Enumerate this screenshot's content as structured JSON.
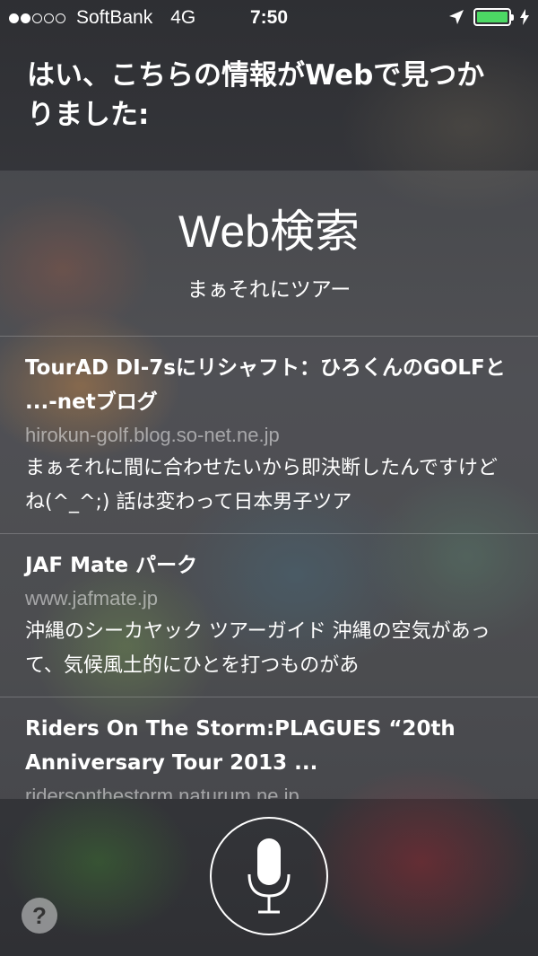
{
  "status_bar": {
    "carrier": "SoftBank",
    "network": "4G",
    "time": "7:50",
    "signal_bars_filled": 2,
    "signal_bars_total": 5,
    "battery_color": "#4cd964",
    "icons": [
      "location-arrow-icon",
      "battery-icon",
      "charging-bolt-icon"
    ]
  },
  "siri": {
    "response": "はい、こちらの情報がWebで見つかりました:"
  },
  "web_search": {
    "title": "Web検索",
    "query": "まぁそれにツアー",
    "results": [
      {
        "title": "TourAD DI-7sにリシャフト：ひろくんのGOLFと ...-netブログ",
        "url": "hirokun-golf.blog.so-net.ne.jp",
        "snippet": "まぁそれに間に合わせたいから即決断したんですけどね(^_^;) 話は変わって日本男子ツア"
      },
      {
        "title": "JAF Mate パーク",
        "url": "www.jafmate.jp",
        "snippet": "沖縄のシーカヤック ツアーガイド 沖縄の空気があって、気候風土的にひとを打つものがあ"
      },
      {
        "title": "Riders On The Storm:PLAGUES “20th Anniversary Tour 2013 ...",
        "url": "ridersonthestorm.naturum.ne.jp",
        "snippet": ""
      }
    ]
  },
  "controls": {
    "mic_icon": "microphone-icon",
    "help_label": "?"
  }
}
